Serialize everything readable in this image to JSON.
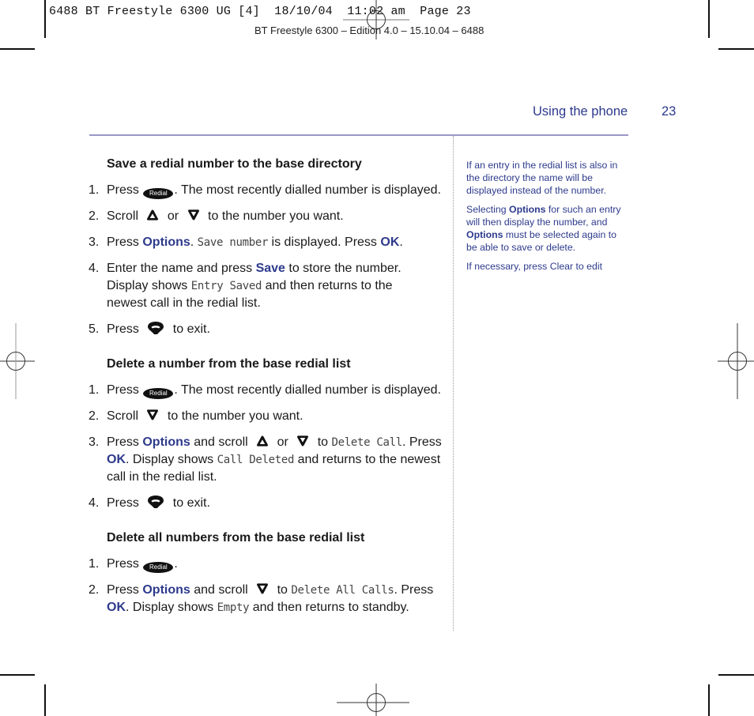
{
  "slug": {
    "text": "6488 BT Freestyle 6300 UG [4]  18/10/04  11:02 am  Page 23",
    "edition": "BT Freestyle 6300 – Edition 4.0 – 15.10.04 – 6488"
  },
  "header": {
    "running_title": "Using the phone",
    "page_number": "23"
  },
  "colors": {
    "accent": "#2d3a8c",
    "rule": "#9b98c8",
    "body_text": "#1a1a1a"
  },
  "icons": {
    "redial_label": "Redial"
  },
  "sections": [
    {
      "heading": "Save a redial number to the base directory",
      "steps": [
        {
          "n": "1.",
          "a": "Press ",
          "b": ". The most recently dialled number is displayed."
        },
        {
          "n": "2.",
          "a": "Scroll ",
          "or": " or ",
          "b": " to the number you want."
        },
        {
          "n": "3.",
          "a": "Press ",
          "kw1": "Options",
          "b": ". ",
          "lcd": "Save number",
          "c": " is displayed. Press ",
          "kw2": "OK",
          "d": "."
        },
        {
          "n": "4.",
          "a": "Enter the name and press ",
          "kw1": "Save",
          "b": " to store the number. Display shows ",
          "lcd": "Entry Saved",
          "c": " and then returns to the newest call in the redial list."
        },
        {
          "n": "5.",
          "a": "Press ",
          "b": " to exit."
        }
      ]
    },
    {
      "heading": "Delete a number from the base redial list",
      "steps": [
        {
          "n": "1.",
          "a": "Press ",
          "b": ". The most recently dialled number is displayed."
        },
        {
          "n": "2.",
          "a": "Scroll ",
          "b": " to the number you want."
        },
        {
          "n": "3.",
          "a": "Press ",
          "kw1": "Options",
          "b": " and scroll ",
          "or": " or ",
          "c": " to ",
          "lcd1": "Delete Call",
          "d": ". Press ",
          "kw2": "OK",
          "e": ". Display shows ",
          "lcd2": "Call Deleted",
          "f": " and returns to the newest call in the redial list."
        },
        {
          "n": "4.",
          "a": "Press ",
          "b": " to exit."
        }
      ]
    },
    {
      "heading": "Delete all numbers from the base redial list",
      "steps": [
        {
          "n": "1.",
          "a": "Press ",
          "b": "."
        },
        {
          "n": "2.",
          "a": "Press ",
          "kw1": "Options",
          "b": " and scroll ",
          "c": " to ",
          "lcd1": "Delete All Calls",
          "d": ". Press ",
          "kw2": "OK",
          "e": ". Display shows ",
          "lcd2": "Empty",
          "f": " and then returns to standby."
        }
      ]
    }
  ],
  "sidebar": {
    "note1": "If an entry in the redial list is also in the directory the name will be displayed instead of the number.",
    "note2_a": "Selecting ",
    "note2_kw1": "Options",
    "note2_b": " for such an entry will then display the number, and ",
    "note2_kw2": "Options",
    "note2_c": " must be selected again to be able to save or delete.",
    "note3": "If necessary, press Clear to edit"
  }
}
